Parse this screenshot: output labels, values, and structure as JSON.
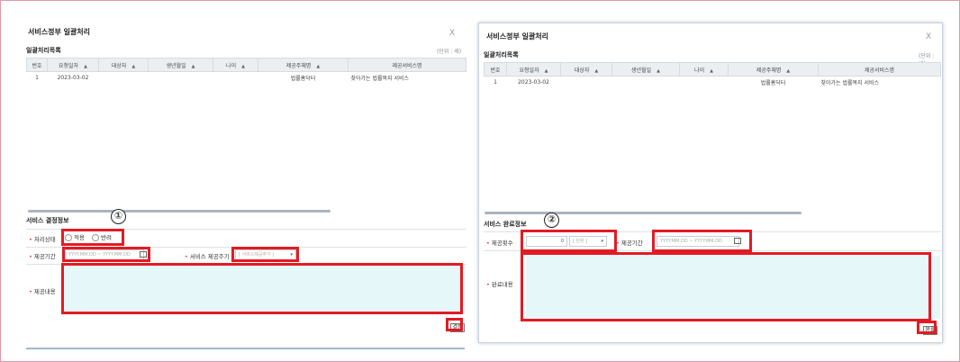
{
  "colors": {
    "highlight": "#e21b23",
    "frame": "#e29aa8",
    "textarea": "#e6f7f9",
    "required": "#e0393e"
  },
  "dialog1": {
    "title": "서비스정부 일괄처리",
    "close": "X",
    "list_title": "일괄처리목록",
    "unit": "(단위 : 세)",
    "columns": [
      "번호",
      "요청일자",
      "대상자",
      "생년월일",
      "나이",
      "제공주체명",
      "제공서비스명"
    ],
    "rows": [
      [
        "1",
        "2023-03-02",
        "",
        "",
        "",
        "법률홈닥터",
        "찾아가는 법률복지 서비스"
      ]
    ],
    "section_title": "서비스 결정정보",
    "marker": "①",
    "status_label": "처리상태",
    "radio_approve": "적용",
    "radio_reject": "반려",
    "period_label": "제공기간",
    "period_placeholder": "YYYY.MM.DD ~ YYYY.MM.DD",
    "cycle_label": "서비스 제공주기",
    "cycle_value": "[ 서비스제공주기 ]",
    "content_label": "제공내용",
    "confirm_button": "결정"
  },
  "dialog2": {
    "title": "서비스정부 일괄처리",
    "close": "X",
    "list_title": "일괄처리목록",
    "unit": "(단위 : 세)",
    "columns": [
      "번호",
      "요청일자",
      "대상자",
      "생년월일",
      "나이",
      "제공주체명",
      "제공서비스명"
    ],
    "rows": [
      [
        "1",
        "2023-03-02",
        "",
        "",
        "",
        "법률홈닥터",
        "찾아가는 법률복지 서비스"
      ]
    ],
    "section_title": "서비스 완료정보",
    "marker": "②",
    "count_label": "제공횟수",
    "count_value": "0",
    "count_unit": "[ 단위 ]",
    "period_label": "제공기간",
    "period_placeholder": "YYYY.MM.DD ~ YYYY.MM.DD",
    "content_label": "완료내용",
    "done_button": "완료"
  }
}
